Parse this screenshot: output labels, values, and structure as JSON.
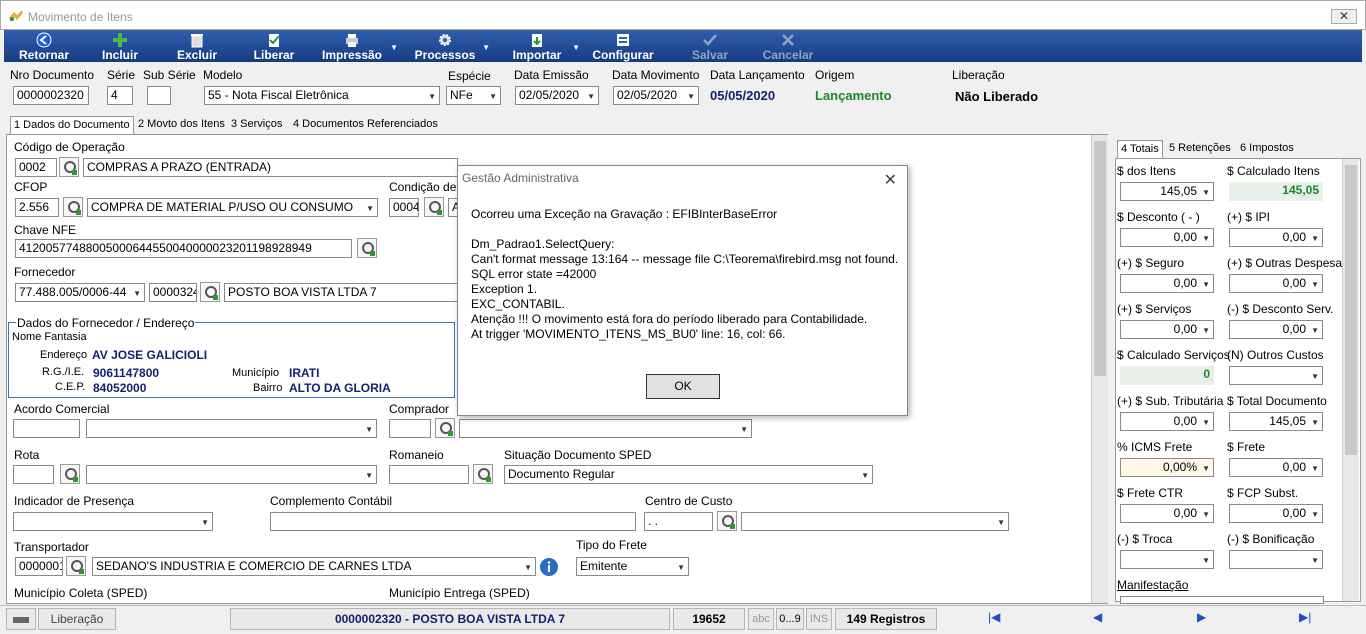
{
  "window": {
    "title": "Movimento de Itens",
    "close": "✕"
  },
  "toolbar": {
    "retornar": "Retornar",
    "incluir": "Incluir",
    "excluir": "Excluir",
    "liberar": "Liberar",
    "impressao": "Impressão",
    "processos": "Processos",
    "importar": "Importar",
    "configurar": "Configurar",
    "salvar": "Salvar",
    "cancelar": "Cancelar"
  },
  "header": {
    "nro_label": "Nro Documento",
    "nro": "0000002320",
    "serie_label": "Série",
    "serie": "4",
    "subserie_label": "Sub Série",
    "subserie": "",
    "modelo_label": "Modelo",
    "modelo": "55 - Nota Fiscal Eletrônica",
    "especie_label": "Espécie",
    "especie": "NFe",
    "emissao_label": "Data Emissão",
    "emissao": "02/05/2020",
    "movimento_label": "Data Movimento",
    "movimento": "02/05/2020",
    "lancamento_label": "Data Lançamento",
    "lancamento": "05/05/2020",
    "origem_label": "Origem",
    "origem": "Lançamento",
    "liberacao_label": "Liberação",
    "liberacao": "Não Liberado"
  },
  "tabs": [
    "1 Dados do Documento",
    "2 Movto dos Itens",
    "3 Serviços",
    "4 Documentos Referenciados"
  ],
  "form": {
    "cod_op_label": "Código de Operação",
    "cod_op": "0002",
    "cod_op_desc": "COMPRAS A PRAZO (ENTRADA)",
    "cfop_label": "CFOP",
    "cfop": "2.556",
    "cfop_desc": "COMPRA DE MATERIAL P/USO OU CONSUMO",
    "cond_label": "Condição de",
    "cond": "0004",
    "cond_desc": "A",
    "chave_label": "Chave NFE",
    "chave": "41200577488005000644550040000023201198928949",
    "fornecedor_label": "Fornecedor",
    "forn_cnpj": "77.488.005/0006-44",
    "forn_cod": "0000324",
    "forn_nome": "POSTO BOA VISTA LTDA 7",
    "gb_title": "Dados do Fornecedor  / Endereço",
    "fantasia_label": "Nome Fantasia",
    "end_label": "Endereço",
    "endereco": "AV JOSE GALICIOLI",
    "rg_label": "R.G./I.E.",
    "rg": "9061147800",
    "mun_label": "Município",
    "municipio": "IRATI",
    "cep_label": "C.E.P.",
    "cep": "84052000",
    "bairro_label": "Bairro",
    "bairro": "ALTO DA GLORIA",
    "acordo_label": "Acordo Comercial",
    "comprador_label": "Comprador",
    "rota_label": "Rota",
    "romaneio_label": "Romaneio",
    "situacao_label": "Situação Documento SPED",
    "situacao": "Documento Regular",
    "ind_pres_label": "Indicador de Presença",
    "compl_label": "Complemento Contábil",
    "centro_label": "Centro de Custo",
    "centro": "  .  .",
    "transp_label": "Transportador",
    "transp_cod": "0000001",
    "transp_nome": "SEDANO'S INDUSTRIA E COMERCIO DE CARNES LTDA",
    "tipo_frete_label": "Tipo do Frete",
    "tipo_frete": "Emitente",
    "mun_coleta_label": "Município Coleta (SPED)",
    "mun_entrega_label": "Município Entrega (SPED)"
  },
  "right": {
    "tabs": [
      "4 Totais",
      "5 Retenções",
      "6 Impostos"
    ],
    "fields": [
      {
        "label": "$ dos Itens",
        "value": "145,05"
      },
      {
        "label": "$ Calculado Itens",
        "value": "145,05"
      },
      {
        "label": "$ Desconto ( - )",
        "value": "0,00"
      },
      {
        "label": "(+) $ IPI",
        "value": "0,00"
      },
      {
        "label": "(+) $ Seguro",
        "value": "0,00"
      },
      {
        "label": "(+) $ Outras Despesa",
        "value": "0,00"
      },
      {
        "label": "(+) $ Serviços",
        "value": "0,00"
      },
      {
        "label": "(-) $ Desconto Serv.",
        "value": "0,00"
      },
      {
        "label": "$ Calculado Serviços",
        "value": "0"
      },
      {
        "label": "(N) Outros Custos",
        "value": ""
      },
      {
        "label": "(+) $ Sub. Tributária",
        "value": "0,00"
      },
      {
        "label": "$ Total Documento",
        "value": "145,05"
      },
      {
        "label": "% ICMS Frete",
        "value": "0,00%"
      },
      {
        "label": "$ Frete",
        "value": "0,00"
      },
      {
        "label": "$ Frete CTR",
        "value": "0,00"
      },
      {
        "label": "$ FCP Subst.",
        "value": "0,00"
      },
      {
        "label": "(-) $ Troca",
        "value": ""
      },
      {
        "label": "(-) $ Bonificação",
        "value": ""
      }
    ],
    "manifest_label": "Manifestação"
  },
  "dialog": {
    "title": "Gestão Administrativa",
    "lines": [
      "Ocorreu uma Exceção na Gravação : EFIBInterBaseError",
      "",
      "Dm_Padrao1.SelectQuery:",
      "Can't format message 13:164 -- message file C:\\Teorema\\firebird.msg not found.",
      "SQL error state =42000",
      "Exception 1.",
      "EXC_CONTABIL.",
      "Atenção !!! O movimento está fora do período liberado para Contabilidade.",
      "At trigger 'MOVIMENTO_ITENS_MS_BU0' line: 16, col: 66."
    ],
    "ok": "OK"
  },
  "status": {
    "liberacao": "Liberação",
    "doc": "0000002320 - POSTO BOA VISTA LTDA 7",
    "num": "19652",
    "abc": "abc",
    "n09": "0...9",
    "ins": "INS",
    "registros": "149 Registros"
  }
}
